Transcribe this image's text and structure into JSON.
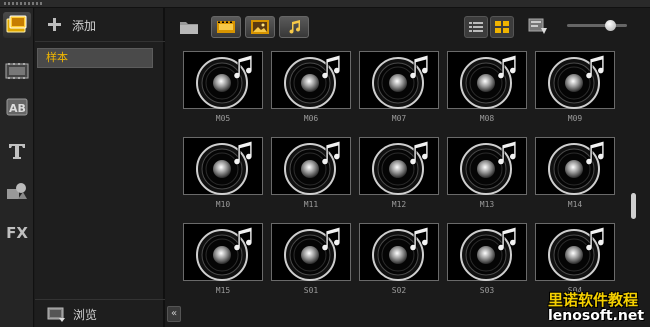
{
  "library": {
    "add_label": "添加",
    "items": [
      {
        "label": "样本",
        "selected": true
      }
    ],
    "browse_label": "浏览"
  },
  "rail": {
    "icons": [
      "media-icon",
      "transition-icon",
      "title-ab-icon",
      "text-t-icon",
      "graphics-icon",
      "fx-icon"
    ],
    "fx_label": "FX"
  },
  "toolbar": {
    "filters": [
      "show-video-icon",
      "show-photo-icon",
      "show-audio-icon"
    ],
    "views": [
      "list-view-icon",
      "thumbnail-view-icon"
    ],
    "thumb_size_level": 0.72
  },
  "grid": {
    "items": [
      {
        "label": "M05"
      },
      {
        "label": "M06"
      },
      {
        "label": "M07"
      },
      {
        "label": "M08"
      },
      {
        "label": "M09"
      },
      {
        "label": "M10"
      },
      {
        "label": "M11"
      },
      {
        "label": "M12"
      },
      {
        "label": "M13"
      },
      {
        "label": "M14"
      },
      {
        "label": "M15"
      },
      {
        "label": "S01"
      },
      {
        "label": "S02"
      },
      {
        "label": "S03"
      },
      {
        "label": "S04"
      }
    ]
  },
  "collapse_label": "«",
  "watermark": {
    "line1": "里诺软件教程",
    "line2": "lenosoft.net"
  },
  "colors": {
    "selected_text": "#f2b700",
    "background": "#1b1b1b"
  }
}
